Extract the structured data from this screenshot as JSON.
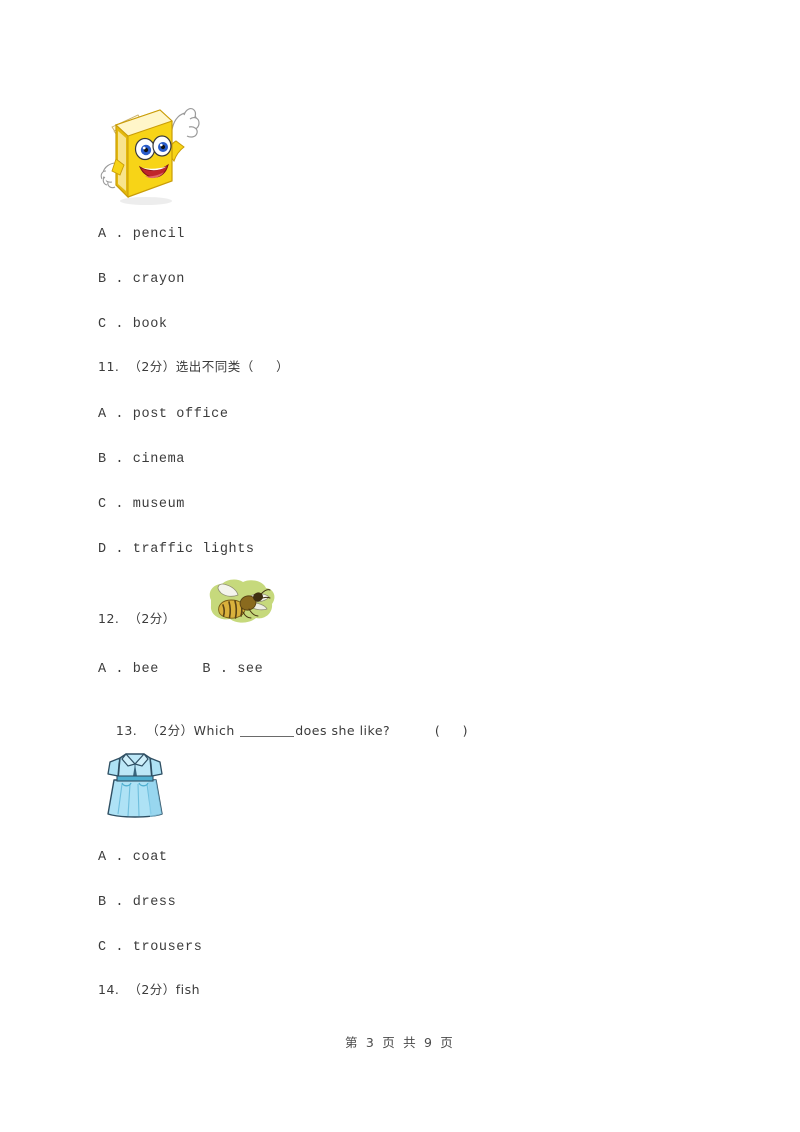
{
  "document": {
    "page_background": "#ffffff",
    "text_color": "#3b3b3b"
  },
  "questions": [
    {
      "id": "q10-continued",
      "image": {
        "name": "cartoon-book-image",
        "description": "yellow cartoon book with face and raised hand",
        "colors": {
          "body": "#F7D417",
          "shade": "#E3B80C",
          "pages": "#FFF8DC",
          "bookmark": "#E23A28",
          "eye": "#2A5CC8",
          "mouth": "#C0262B",
          "hand": "#FFFFFF"
        }
      },
      "options": [
        {
          "label": "A",
          "text": "A . pencil"
        },
        {
          "label": "B",
          "text": "B . crayon"
        },
        {
          "label": "C",
          "text": "C . book"
        }
      ]
    },
    {
      "id": "q11",
      "number": "11.",
      "score": "（2分）",
      "prompt": "选出不同类（     ）",
      "stem_full": "11.  （2分）选出不同类（     ）",
      "options": [
        {
          "label": "A",
          "text": "A . post office"
        },
        {
          "label": "B",
          "text": "B . cinema"
        },
        {
          "label": "C",
          "text": "C . museum"
        },
        {
          "label": "D",
          "text": "D . traffic lights"
        }
      ]
    },
    {
      "id": "q12",
      "number": "12.",
      "score": "（2分）",
      "stem_full": "12.  （2分）",
      "image": {
        "name": "bee-image",
        "description": "bee on a light green blob background",
        "colors": {
          "blob": "#C6D97C",
          "body": "#D9B13C",
          "stripe": "#5A4416",
          "wing": "#F2F2EA"
        }
      },
      "options_inline": "A . bee     B . see",
      "options": [
        {
          "label": "A",
          "text": "A . bee"
        },
        {
          "label": "B",
          "text": "B . see"
        }
      ]
    },
    {
      "id": "q13",
      "number": "13.",
      "score": "（2分）",
      "stem_prefix": "13.  （2分）Which ",
      "stem_suffix": "does she like?          (     )",
      "stem_full": "13.  （2分）Which ______does she like?          (     )",
      "image": {
        "name": "dress-image",
        "description": "light blue short-sleeve dress with collar and pleated skirt",
        "colors": {
          "fabric": "#AEE2F5",
          "shade": "#7EC8E8",
          "outline": "#2F4F63",
          "belt": "#4FAFD0"
        }
      },
      "options": [
        {
          "label": "A",
          "text": "A . coat"
        },
        {
          "label": "B",
          "text": "B . dress"
        },
        {
          "label": "C",
          "text": "C . trousers"
        }
      ]
    },
    {
      "id": "q14",
      "number": "14.",
      "score": "（2分）",
      "stem_full": "14.  （2分）fish"
    }
  ],
  "footer": {
    "text": "第 3 页 共 9 页",
    "page_number": "3",
    "total_pages": "9"
  }
}
